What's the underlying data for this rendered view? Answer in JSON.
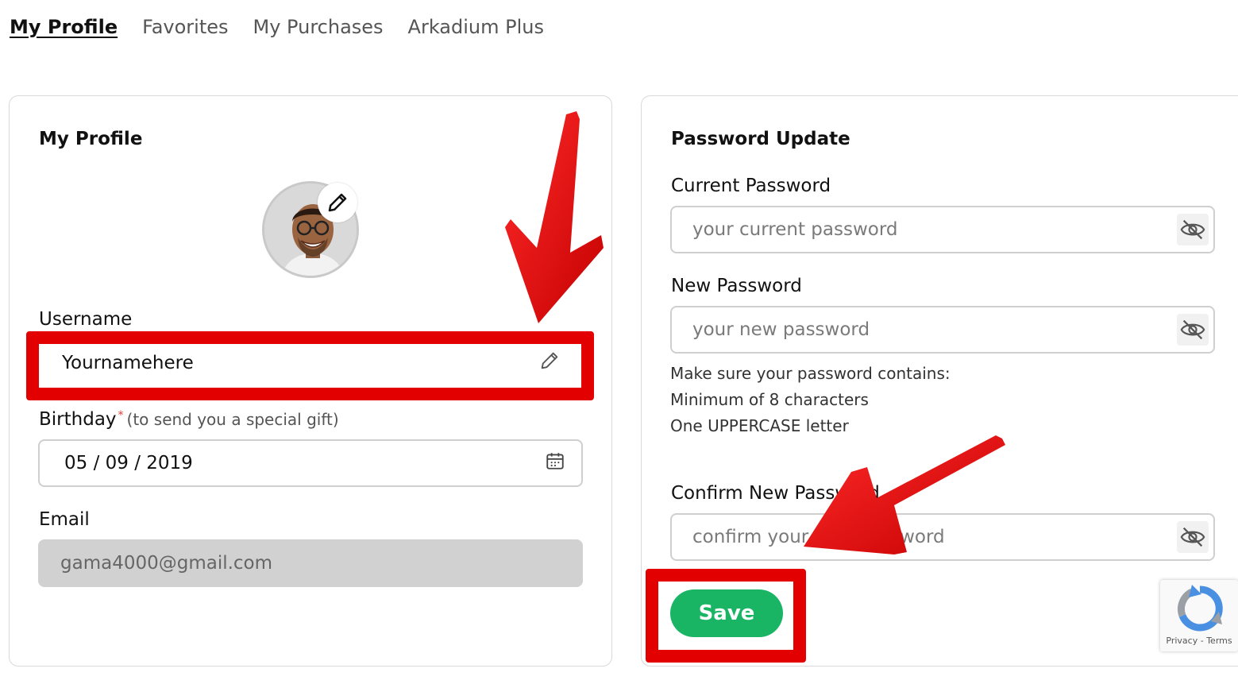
{
  "tabs": [
    {
      "label": "My Profile",
      "active": true
    },
    {
      "label": "Favorites",
      "active": false
    },
    {
      "label": "My Purchases",
      "active": false
    },
    {
      "label": "Arkadium Plus",
      "active": false
    }
  ],
  "profile": {
    "title": "My Profile",
    "username_label": "Username",
    "username_value": "Yournamehere",
    "birthday_label": "Birthday",
    "birthday_required": "*",
    "birthday_hint": "(to send you a special gift)",
    "birthday_value": "05 / 09 / 2019",
    "email_label": "Email",
    "email_value": "gama4000@gmail.com"
  },
  "password": {
    "title": "Password Update",
    "current_label": "Current Password",
    "current_placeholder": "your current password",
    "new_label": "New Password",
    "new_placeholder": "your new password",
    "rules_intro": "Make sure your password contains:",
    "rule_1": "Minimum of 8 characters",
    "rule_2": "One UPPERCASE letter",
    "confirm_label": "Confirm New Password",
    "confirm_placeholder": "confirm your new password",
    "save_label": "Save"
  },
  "recaptcha": {
    "terms": "Privacy - Terms"
  },
  "icons": {
    "avatar_edit": "pencil-icon",
    "username_edit": "pencil-icon",
    "calendar": "calendar-icon",
    "password_toggle": "eye-slash-icon"
  },
  "colors": {
    "accent_green": "#1ab564",
    "annotation_red": "#e30000",
    "disabled_field": "#d1d1d1"
  }
}
